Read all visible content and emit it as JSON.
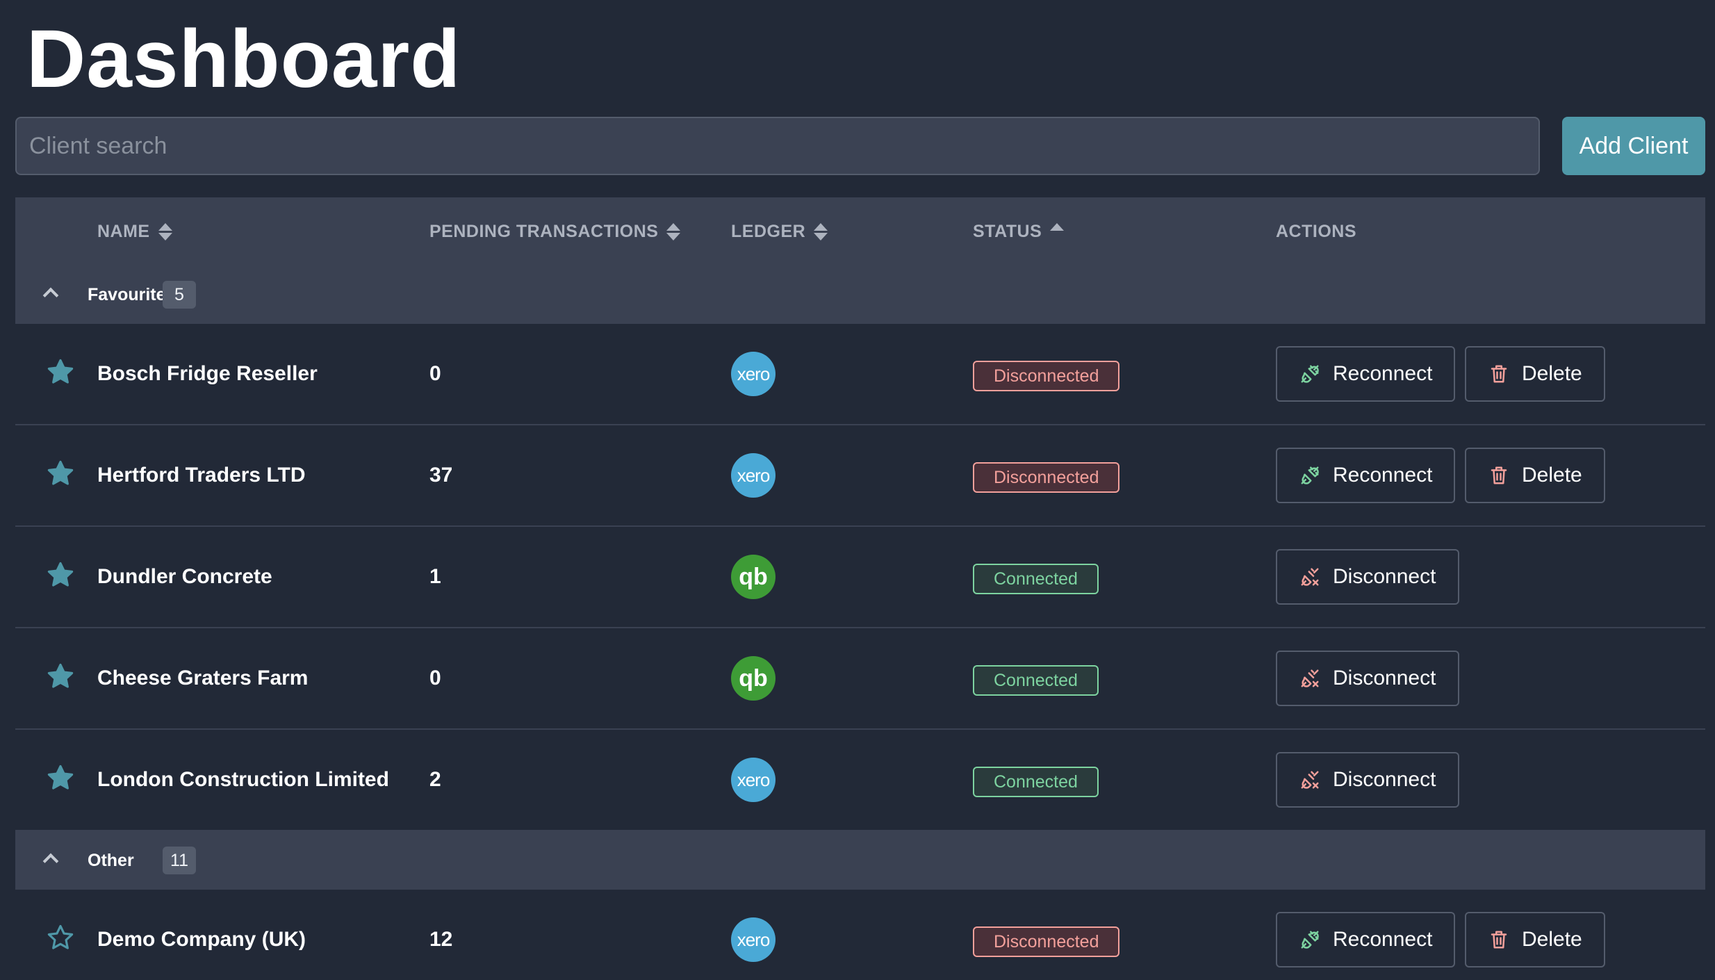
{
  "page": {
    "title": "Dashboard"
  },
  "search": {
    "placeholder": "Client search"
  },
  "add_client": {
    "label": "Add Client"
  },
  "columns": {
    "name": "NAME",
    "pending": "PENDING TRANSACTIONS",
    "ledger": "LEDGER",
    "status": "STATUS",
    "actions": "ACTIONS"
  },
  "sort": {
    "name": "both",
    "pending": "both",
    "ledger": "both",
    "status": "ascending"
  },
  "actions": {
    "reconnect": "Reconnect",
    "delete": "Delete",
    "disconnect": "Disconnect"
  },
  "ledger_icons": {
    "xero": "xero",
    "quickbooks": "qb"
  },
  "colors": {
    "accent": "#4f98a8",
    "star": "#4f98a8",
    "disconnected": "#f3a09b",
    "connected": "#7dd3a0",
    "xero": "#4aa9d6",
    "quickbooks": "#3e9c36"
  },
  "groups": [
    {
      "name": "Favourites",
      "count": "5",
      "rows": [
        {
          "name": "Bosch Fridge Reseller",
          "pending": "0",
          "ledger": "xero",
          "status": "Disconnected",
          "favourite": true
        },
        {
          "name": "Hertford Traders LTD",
          "pending": "37",
          "ledger": "xero",
          "status": "Disconnected",
          "favourite": true
        },
        {
          "name": "Dundler Concrete",
          "pending": "1",
          "ledger": "quickbooks",
          "status": "Connected",
          "favourite": true
        },
        {
          "name": "Cheese Graters Farm",
          "pending": "0",
          "ledger": "quickbooks",
          "status": "Connected",
          "favourite": true
        },
        {
          "name": "London Construction Limited",
          "pending": "2",
          "ledger": "xero",
          "status": "Connected",
          "favourite": true
        }
      ]
    },
    {
      "name": "Other",
      "count": "11",
      "rows": [
        {
          "name": "Demo Company (UK)",
          "pending": "12",
          "ledger": "xero",
          "status": "Disconnected",
          "favourite": false
        }
      ]
    }
  ]
}
